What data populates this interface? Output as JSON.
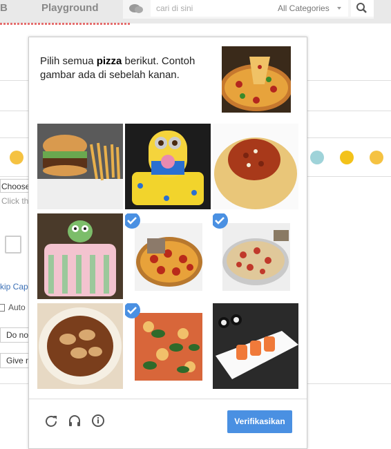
{
  "topbar": {
    "brand_fragment": "B",
    "playground_label": "Playground",
    "search_placeholder": "cari di sini",
    "category_selected": "All Categories"
  },
  "background": {
    "choose_label": "Choose",
    "click_hint": "Click th",
    "skip_link": "kip Cap",
    "auto_label": "Auto",
    "do_not_label": "Do no",
    "give_label": "Give n"
  },
  "captcha": {
    "instruction_prefix": "Pilih semua ",
    "instruction_keyword": "pizza",
    "instruction_suffix": " berikut. Contoh gambar ada di sebelah kanan.",
    "example_image": "pizza-slice-lift",
    "tiles": [
      {
        "subject": "burger-with-fries",
        "selected": false
      },
      {
        "subject": "minion-cake",
        "selected": false
      },
      {
        "subject": "spaghetti-bolognese",
        "selected": false
      },
      {
        "subject": "owl-birthday-cake",
        "selected": false
      },
      {
        "subject": "pepperoni-pizza",
        "selected": true
      },
      {
        "subject": "pizza-on-tray",
        "selected": true
      },
      {
        "subject": "dumpling-soup",
        "selected": false
      },
      {
        "subject": "basil-pizza",
        "selected": true
      },
      {
        "subject": "sushi-plate",
        "selected": false
      }
    ],
    "verify_label": "Verifikasikan",
    "accent_color": "#4a90e2"
  },
  "icons": {
    "reload": "reload-icon",
    "audio": "headphones-icon",
    "info": "info-icon",
    "search": "search-icon"
  }
}
